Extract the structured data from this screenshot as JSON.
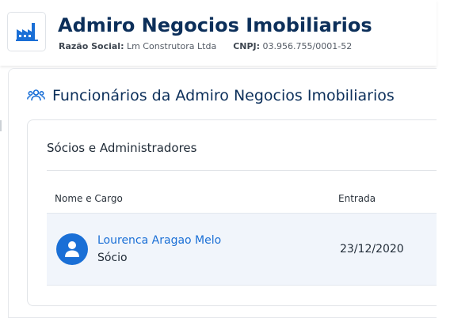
{
  "header": {
    "company_name": "Admiro Negocios Imobiliarios",
    "razao_social_label": "Razão Social:",
    "razao_social_value": "Lm Construtora Ltda",
    "cnpj_label": "CNPJ:",
    "cnpj_value": "03.956.755/0001-52",
    "logo_icon": "factory-icon"
  },
  "section": {
    "icon": "people-icon",
    "title": "Funcionários da Admiro Negocios Imobiliarios"
  },
  "card": {
    "title": "Sócios e Administradores",
    "columns": [
      "Nome e Cargo",
      "Entrada"
    ],
    "rows": [
      {
        "name": "Lourenca Aragao Melo",
        "role": "Sócio",
        "date": "23/12/2020",
        "avatar_icon": "user-icon"
      }
    ]
  },
  "colors": {
    "title": "#0c2f5a",
    "link": "#1a6fd6",
    "row_bg": "#f1f5fb"
  }
}
